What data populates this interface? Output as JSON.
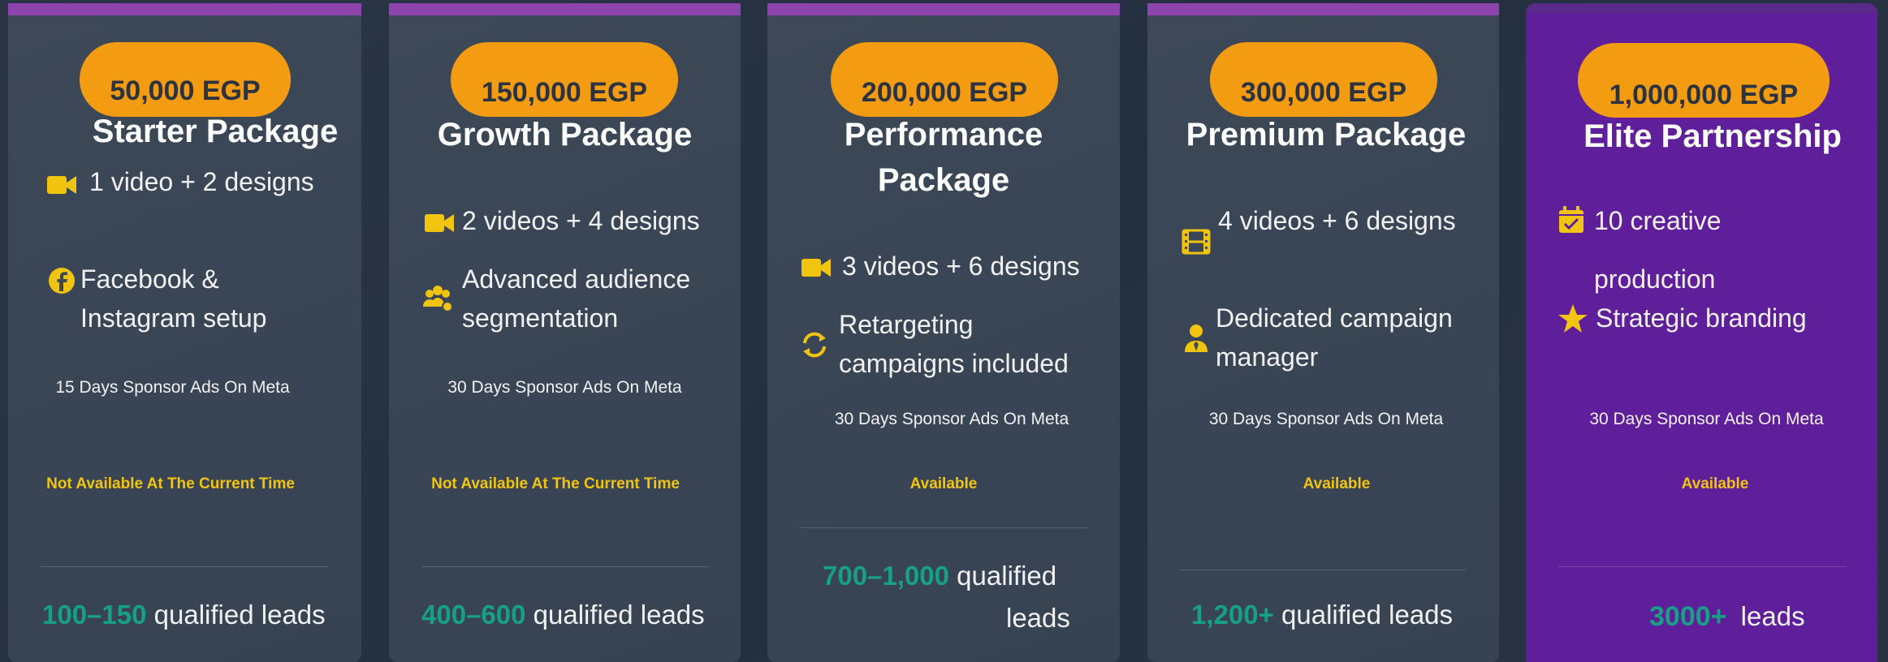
{
  "colors": {
    "accent": "#f39c12",
    "leads": "#16a085",
    "availability": "#f1c40f",
    "elite_bg": "#5f1f9a"
  },
  "cards": [
    {
      "price": "50,000 EGP",
      "title": "Starter Package",
      "features": [
        {
          "icon": "video-camera-icon",
          "text": "1 video + 2 designs"
        },
        {
          "icon": "facebook-icon",
          "text_line1": "Facebook &",
          "text_line2": "Instagram setup"
        }
      ],
      "ads": "15 Days Sponsor Ads On Meta",
      "availability": "Not Available At The Current Time",
      "leads_number": "100–150",
      "leads_text": "qualified leads"
    },
    {
      "price": "150,000 EGP",
      "title": "Growth Package",
      "features": [
        {
          "icon": "video-camera-icon",
          "text": "2 videos + 4 designs"
        },
        {
          "icon": "audience-group-icon",
          "text_line1": "Advanced audience",
          "text_line2": "segmentation"
        }
      ],
      "ads": "30 Days Sponsor Ads On Meta",
      "availability": "Not Available At The Current Time",
      "leads_number": "400–600",
      "leads_text": "qualified leads"
    },
    {
      "price": "200,000 EGP",
      "title_line1": "Performance",
      "title_line2": "Package",
      "features": [
        {
          "icon": "video-camera-icon",
          "text": "3 videos + 6 designs"
        },
        {
          "icon": "refresh-icon",
          "text_line1": "Retargeting",
          "text_line2": "campaigns included"
        }
      ],
      "ads": "30 Days Sponsor Ads On Meta",
      "availability": "Available",
      "leads_number": "700–1,000",
      "leads_text_line1": "qualified",
      "leads_text_line2": "leads"
    },
    {
      "price": "300,000 EGP",
      "title": "Premium Package",
      "features": [
        {
          "icon": "film-icon",
          "text": "4 videos + 6 designs"
        },
        {
          "icon": "manager-icon",
          "text_line1": "Dedicated campaign",
          "text_line2": "manager"
        }
      ],
      "ads": "30 Days Sponsor Ads On Meta",
      "availability": "Available",
      "leads_number": "1,200+",
      "leads_text": "qualified leads"
    },
    {
      "price": "1,000,000 EGP",
      "title": "Elite Partnership",
      "features": [
        {
          "icon": "calendar-check-icon",
          "text_line1": "10 creative",
          "text_line2": "production"
        },
        {
          "icon": "star-icon",
          "text": "Strategic branding"
        }
      ],
      "ads": "30 Days Sponsor Ads On Meta",
      "availability": "Available",
      "leads_number": "3000+",
      "leads_text": "leads"
    }
  ]
}
